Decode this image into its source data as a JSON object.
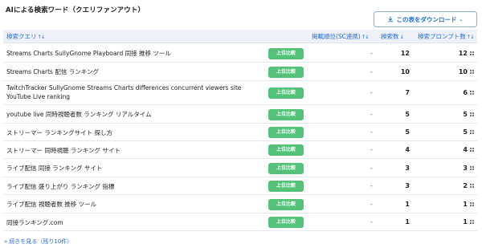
{
  "title": "AIによる検索ワード（クエリファンアウト）",
  "download_button": "この表をダウンロード",
  "columns": {
    "query": "検索クエリ",
    "rank": "掲載順位(SC連携)",
    "count": "検索数",
    "prompt": "検索プロンプト数"
  },
  "compare_label": "上位比較",
  "rows": [
    {
      "query": "Streams Charts SullyGnome Playboard 同接 推移 ツール",
      "rank": "-",
      "count": "12",
      "prompt": "12"
    },
    {
      "query": "Streams Charts 配信 ランキング",
      "rank": "-",
      "count": "10",
      "prompt": "10"
    },
    {
      "query": "TwitchTracker SullyGnome Streams Charts differences concurrent viewers site YouTube Live ranking",
      "rank": "-",
      "count": "7",
      "prompt": "6"
    },
    {
      "query": "youtube live 同時視聴者数 ランキング リアルタイム",
      "rank": "-",
      "count": "5",
      "prompt": "5"
    },
    {
      "query": "ストリーマー ランキングサイト 探し方",
      "rank": "-",
      "count": "5",
      "prompt": "5"
    },
    {
      "query": "ストリーマー 同時視聴 ランキング サイト",
      "rank": "-",
      "count": "4",
      "prompt": "4"
    },
    {
      "query": "ライブ配信 同接 ランキング サイト",
      "rank": "-",
      "count": "3",
      "prompt": "3"
    },
    {
      "query": "ライブ配信 盛り上がり ランキング 指標",
      "rank": "-",
      "count": "3",
      "prompt": "2"
    },
    {
      "query": "ライブ配信 視聴者数 推移 ツール",
      "rank": "-",
      "count": "1",
      "prompt": "1"
    },
    {
      "query": "同接ランキング.com",
      "rank": "-",
      "count": "1",
      "prompt": "1"
    }
  ],
  "show_more": "続きを見る（残り10件）",
  "colors": {
    "accent": "#2a6fd6",
    "compare_button": "#55c27a",
    "header_bg": "#eef2f8"
  }
}
